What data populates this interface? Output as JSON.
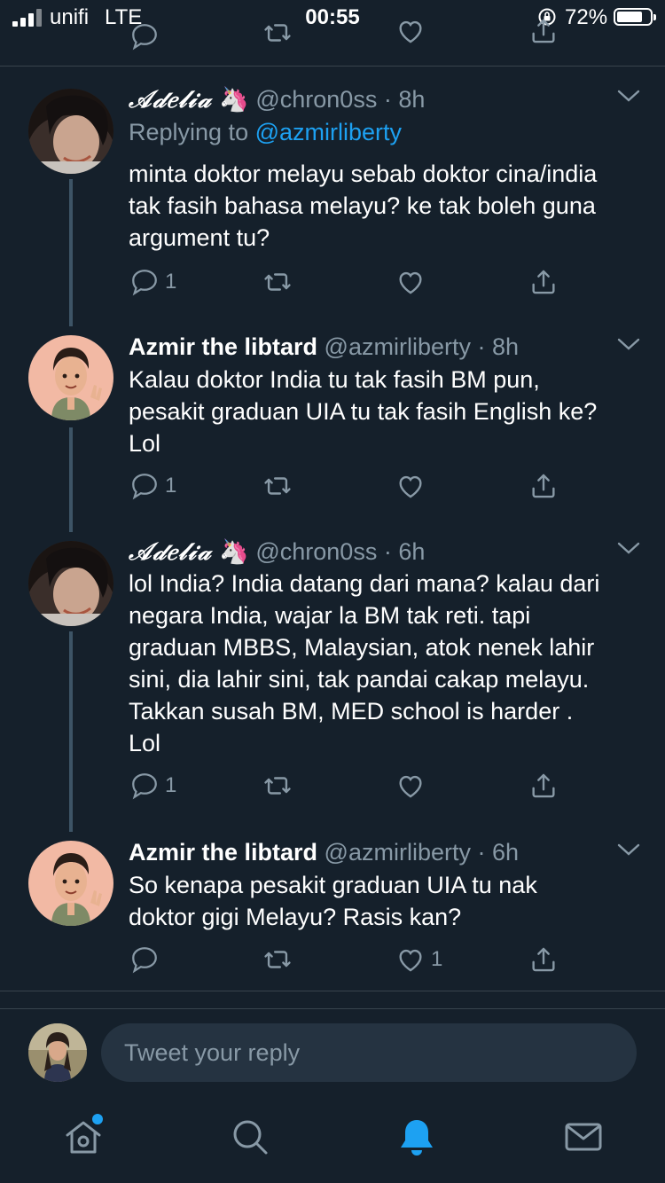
{
  "status_bar": {
    "carrier": "unifi",
    "network": "LTE",
    "time": "00:55",
    "battery": "72%"
  },
  "tweets": [
    {
      "name": "𝒜𝒹𝑒𝓁𝒾𝒶",
      "emoji": "🦄",
      "handle": "@chron0ss",
      "time": "· 8h",
      "replying_prefix": "Replying to",
      "replying_handle": "@azmirliberty",
      "lines": [
        "minta doktor melayu sebab doktor cina/india",
        "tak fasih bahasa melayu? ke tak boleh guna",
        "argument tu?"
      ],
      "reply_count": "1",
      "retweet_count": "",
      "like_count": ""
    },
    {
      "name": "Azmir the libtard",
      "handle": "@azmirliberty",
      "time": "· 8h",
      "lines": [
        "Kalau doktor India tu tak fasih BM pun,",
        "pesakit graduan UIA tu tak fasih English ke?",
        "Lol"
      ],
      "reply_count": "1",
      "retweet_count": "",
      "like_count": ""
    },
    {
      "name": "𝒜𝒹𝑒𝓁𝒾𝒶",
      "emoji": "🦄",
      "handle": "@chron0ss",
      "time": "· 6h",
      "lines": [
        "lol India? India datang dari mana? kalau dari",
        "negara India, wajar la BM tak reti. tapi",
        "graduan MBBS, Malaysian, atok nenek lahir",
        "sini, dia lahir sini, tak pandai cakap melayu.",
        "Takkan susah BM, MED school is harder .",
        "Lol"
      ],
      "reply_count": "1",
      "retweet_count": "",
      "like_count": ""
    },
    {
      "name": "Azmir the libtard",
      "handle": "@azmirliberty",
      "time": "· 6h",
      "lines": [
        "So kenapa pesakit graduan UIA tu nak",
        "doktor gigi Melayu? Rasis kan?"
      ],
      "reply_count": "",
      "retweet_count": "",
      "like_count": "1"
    }
  ],
  "reply_box": {
    "placeholder": "Tweet your reply"
  },
  "tabbar": {
    "items": [
      "home-icon",
      "search-icon",
      "notifications-icon",
      "messages-icon"
    ],
    "active": "notifications-icon"
  },
  "colors": {
    "background": "#15202b",
    "secondary_text": "#8899a6",
    "accent": "#1da1f2",
    "divider": "#38444d",
    "thread_line": "#3d5466"
  }
}
